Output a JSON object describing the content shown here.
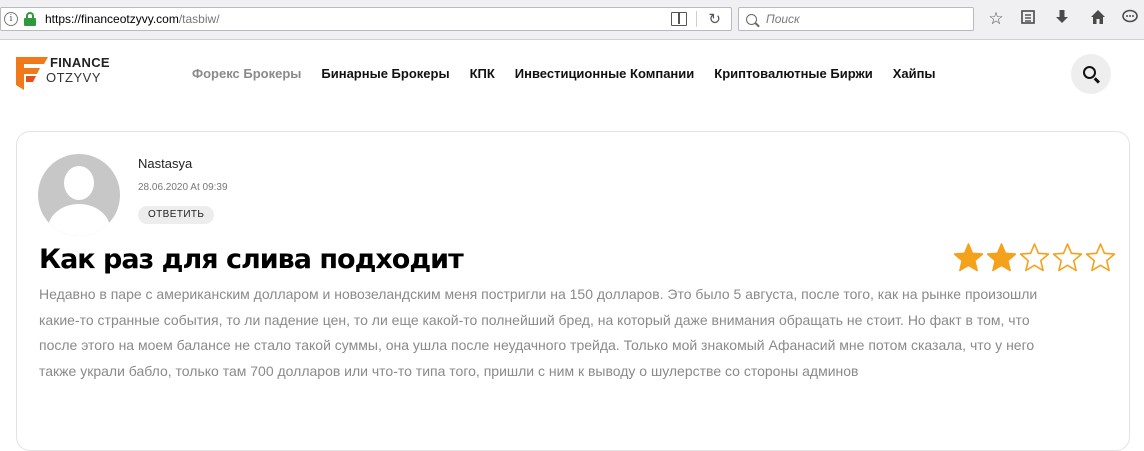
{
  "browser": {
    "url_host": "https://financeotzyvy.com",
    "url_path": "/tasbiw/",
    "search_placeholder": "Поиск"
  },
  "logo": {
    "line1": "FINANCE",
    "line2": "OTZYVY"
  },
  "nav": {
    "items": [
      {
        "label": "Форекс Брокеры",
        "active": true
      },
      {
        "label": "Бинарные Брокеры",
        "active": false
      },
      {
        "label": "КПК",
        "active": false
      },
      {
        "label": "Инвестиционные Компании",
        "active": false
      },
      {
        "label": "Криптовалютные Биржи",
        "active": false
      },
      {
        "label": "Хайпы",
        "active": false
      }
    ]
  },
  "review": {
    "author": "Nastasya",
    "date": "28.06.2020 At 09:39",
    "reply_label": "ОТВЕТИТЬ",
    "title": "Как раз для слива подходит",
    "rating": 2,
    "rating_max": 5,
    "body": "Недавно в паре с американским долларом и новозеландским меня постригли на 150 долларов. Это было 5 августа, после того, как на рынке произошли какие-то странные события, то ли падение цен, то ли еще какой-то полнейший бред, на который даже внимания обращать не стоит. Но факт в том, что после этого на моем балансе не стало такой суммы, она ушла после неудачного трейда. Только мой знакомый Афанасий мне потом сказала, что у него также украли бабло, только там 700 долларов или что-то типа того, пришли с ним к выводу о шулерстве со стороны админов"
  },
  "colors": {
    "star_fill": "#f4a11c",
    "logo_orange": "#f07a1a",
    "nav_active": "#8a8a8a"
  }
}
